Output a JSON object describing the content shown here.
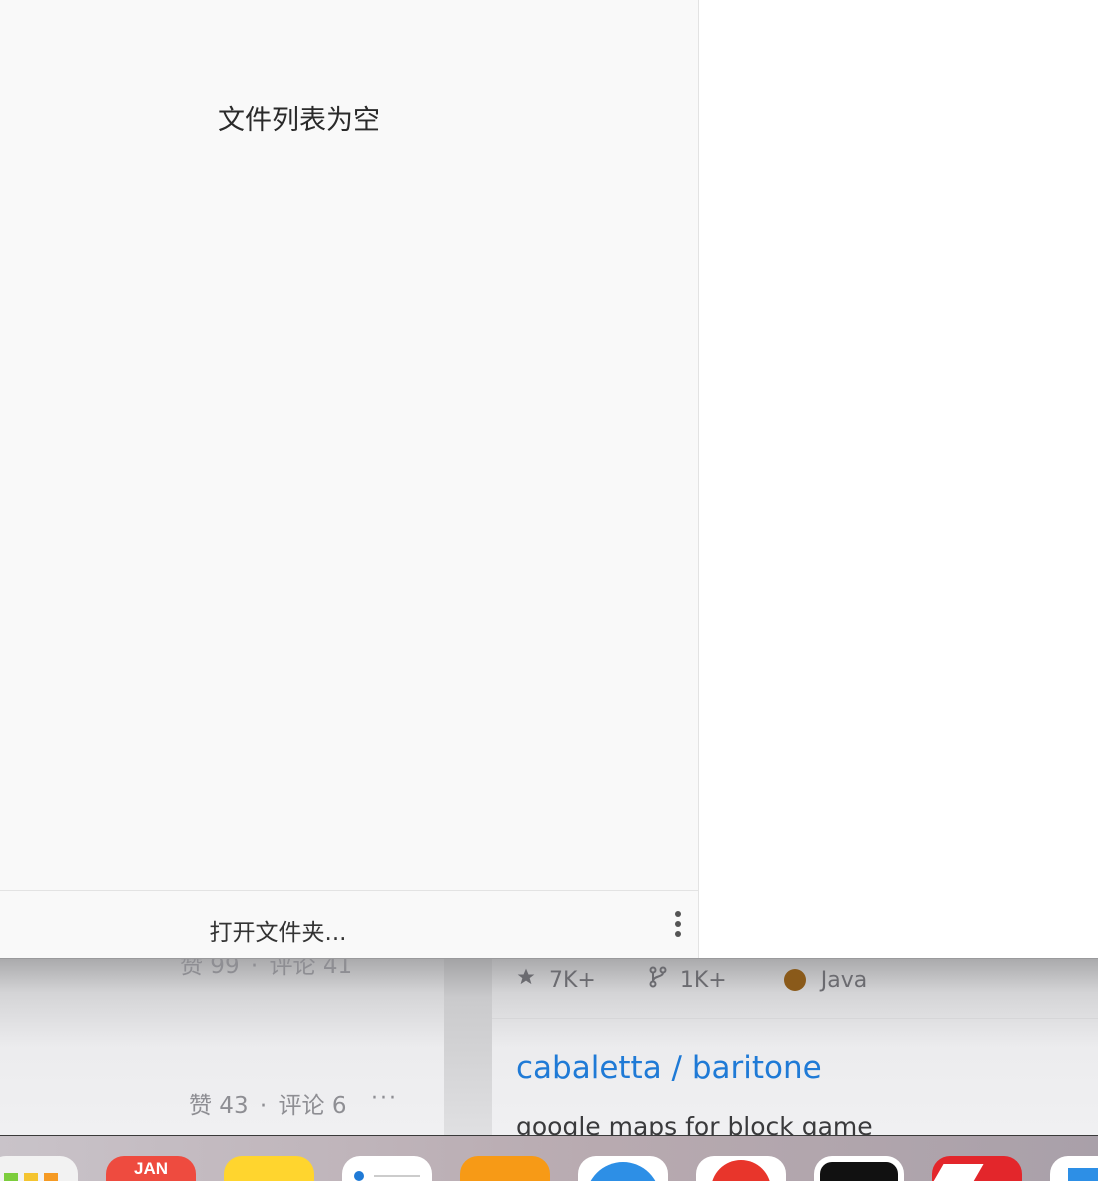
{
  "file_panel": {
    "empty_message": "文件列表为空",
    "open_folder_label": "打开文件夹...",
    "more_icon": "more-vertical-icon"
  },
  "feed": {
    "items": [
      {
        "likes": "赞 99",
        "comments": "评论 41",
        "more": "···"
      },
      {
        "likes": "赞 43",
        "comments": "评论 6",
        "more": "···"
      }
    ],
    "separator": "·"
  },
  "repo_card": {
    "stars": "7K+",
    "forks": "1K+",
    "language": "Java",
    "language_color": "#8a5a1a",
    "title": "cabaletta / baritone",
    "description": "google maps for block game",
    "title_color": "#1f7ad6",
    "star_icon": "star-icon",
    "fork_icon": "fork-icon"
  },
  "dock": {
    "apps": [
      {
        "name": "launchpad-icon"
      },
      {
        "name": "calendar-icon",
        "label": "JAN"
      },
      {
        "name": "notes-icon"
      },
      {
        "name": "reminders-icon"
      },
      {
        "name": "books-icon"
      },
      {
        "name": "safari-icon"
      },
      {
        "name": "red-app-icon"
      },
      {
        "name": "dark-app-icon"
      },
      {
        "name": "pdf-app-icon"
      },
      {
        "name": "blue-app-icon"
      }
    ]
  }
}
